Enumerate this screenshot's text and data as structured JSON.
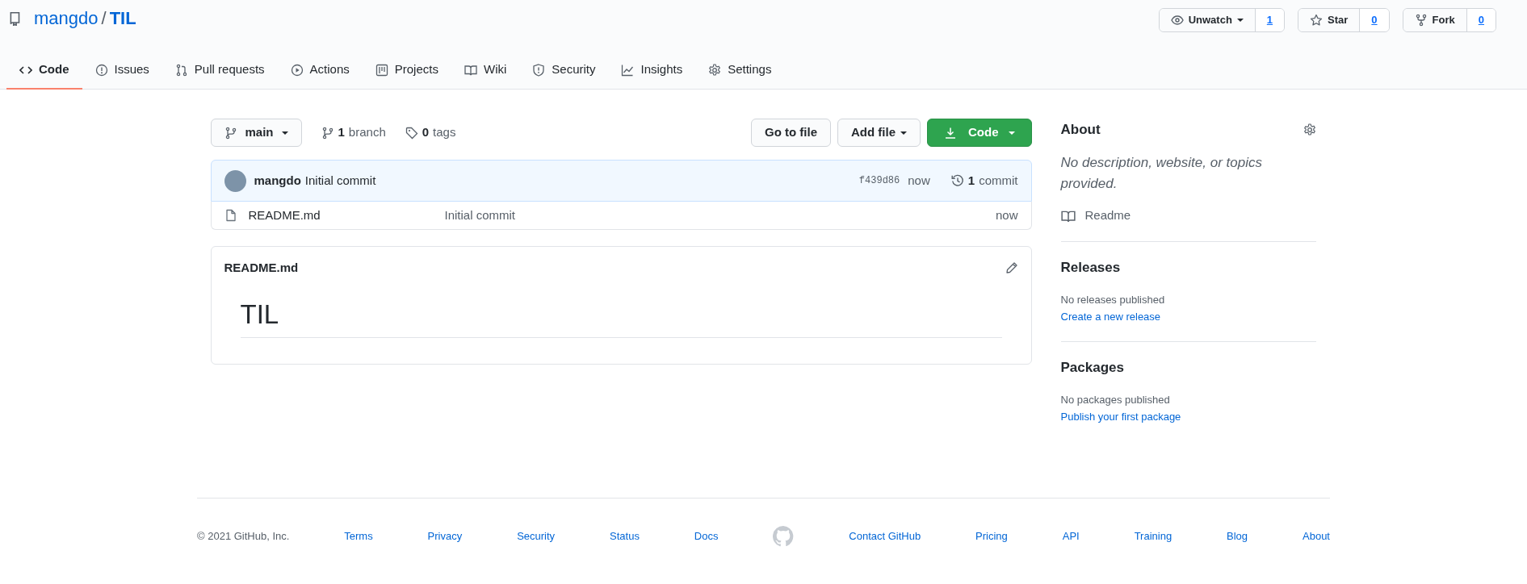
{
  "repo": {
    "owner": "mangdo",
    "separator": "/",
    "name": "TIL"
  },
  "actions": [
    {
      "label": "Unwatch",
      "count": "1",
      "kind": "watch",
      "dropdown": true
    },
    {
      "label": "Star",
      "count": "0",
      "kind": "star",
      "dropdown": false
    },
    {
      "label": "Fork",
      "count": "0",
      "kind": "fork",
      "dropdown": false
    }
  ],
  "tabs": [
    {
      "label": "Code",
      "selected": true,
      "kind": "code"
    },
    {
      "label": "Issues",
      "selected": false,
      "kind": "issues"
    },
    {
      "label": "Pull requests",
      "selected": false,
      "kind": "pulls"
    },
    {
      "label": "Actions",
      "selected": false,
      "kind": "actions"
    },
    {
      "label": "Projects",
      "selected": false,
      "kind": "projects"
    },
    {
      "label": "Wiki",
      "selected": false,
      "kind": "wiki"
    },
    {
      "label": "Security",
      "selected": false,
      "kind": "security"
    },
    {
      "label": "Insights",
      "selected": false,
      "kind": "insights"
    },
    {
      "label": "Settings",
      "selected": false,
      "kind": "settings"
    }
  ],
  "branch_bar": {
    "branch": "main",
    "branches_count": "1",
    "branches_label": "branch",
    "tags_count": "0",
    "tags_label": "tags",
    "go_to_file": "Go to file",
    "add_file": "Add file",
    "code": "Code"
  },
  "commit": {
    "author": "mangdo",
    "message": "Initial commit",
    "sha": "f439d86",
    "time": "now",
    "count": "1",
    "count_label": "commit"
  },
  "files": [
    {
      "name": "README.md",
      "message": "Initial commit",
      "time": "now"
    }
  ],
  "readme": {
    "filename": "README.md",
    "heading": "TIL"
  },
  "sidebar": {
    "about_title": "About",
    "description": "No description, website, or topics provided.",
    "readme_link": "Readme",
    "sections": [
      {
        "title": "Releases",
        "text": "No releases published",
        "link": "Create a new release"
      },
      {
        "title": "Packages",
        "text": "No packages published",
        "link": "Publish your first package"
      }
    ]
  },
  "footer": {
    "copyright": "© 2021 GitHub, Inc.",
    "left_links": [
      "Terms",
      "Privacy",
      "Security",
      "Status",
      "Docs"
    ],
    "right_links": [
      "Contact GitHub",
      "Pricing",
      "API",
      "Training",
      "Blog",
      "About"
    ]
  }
}
